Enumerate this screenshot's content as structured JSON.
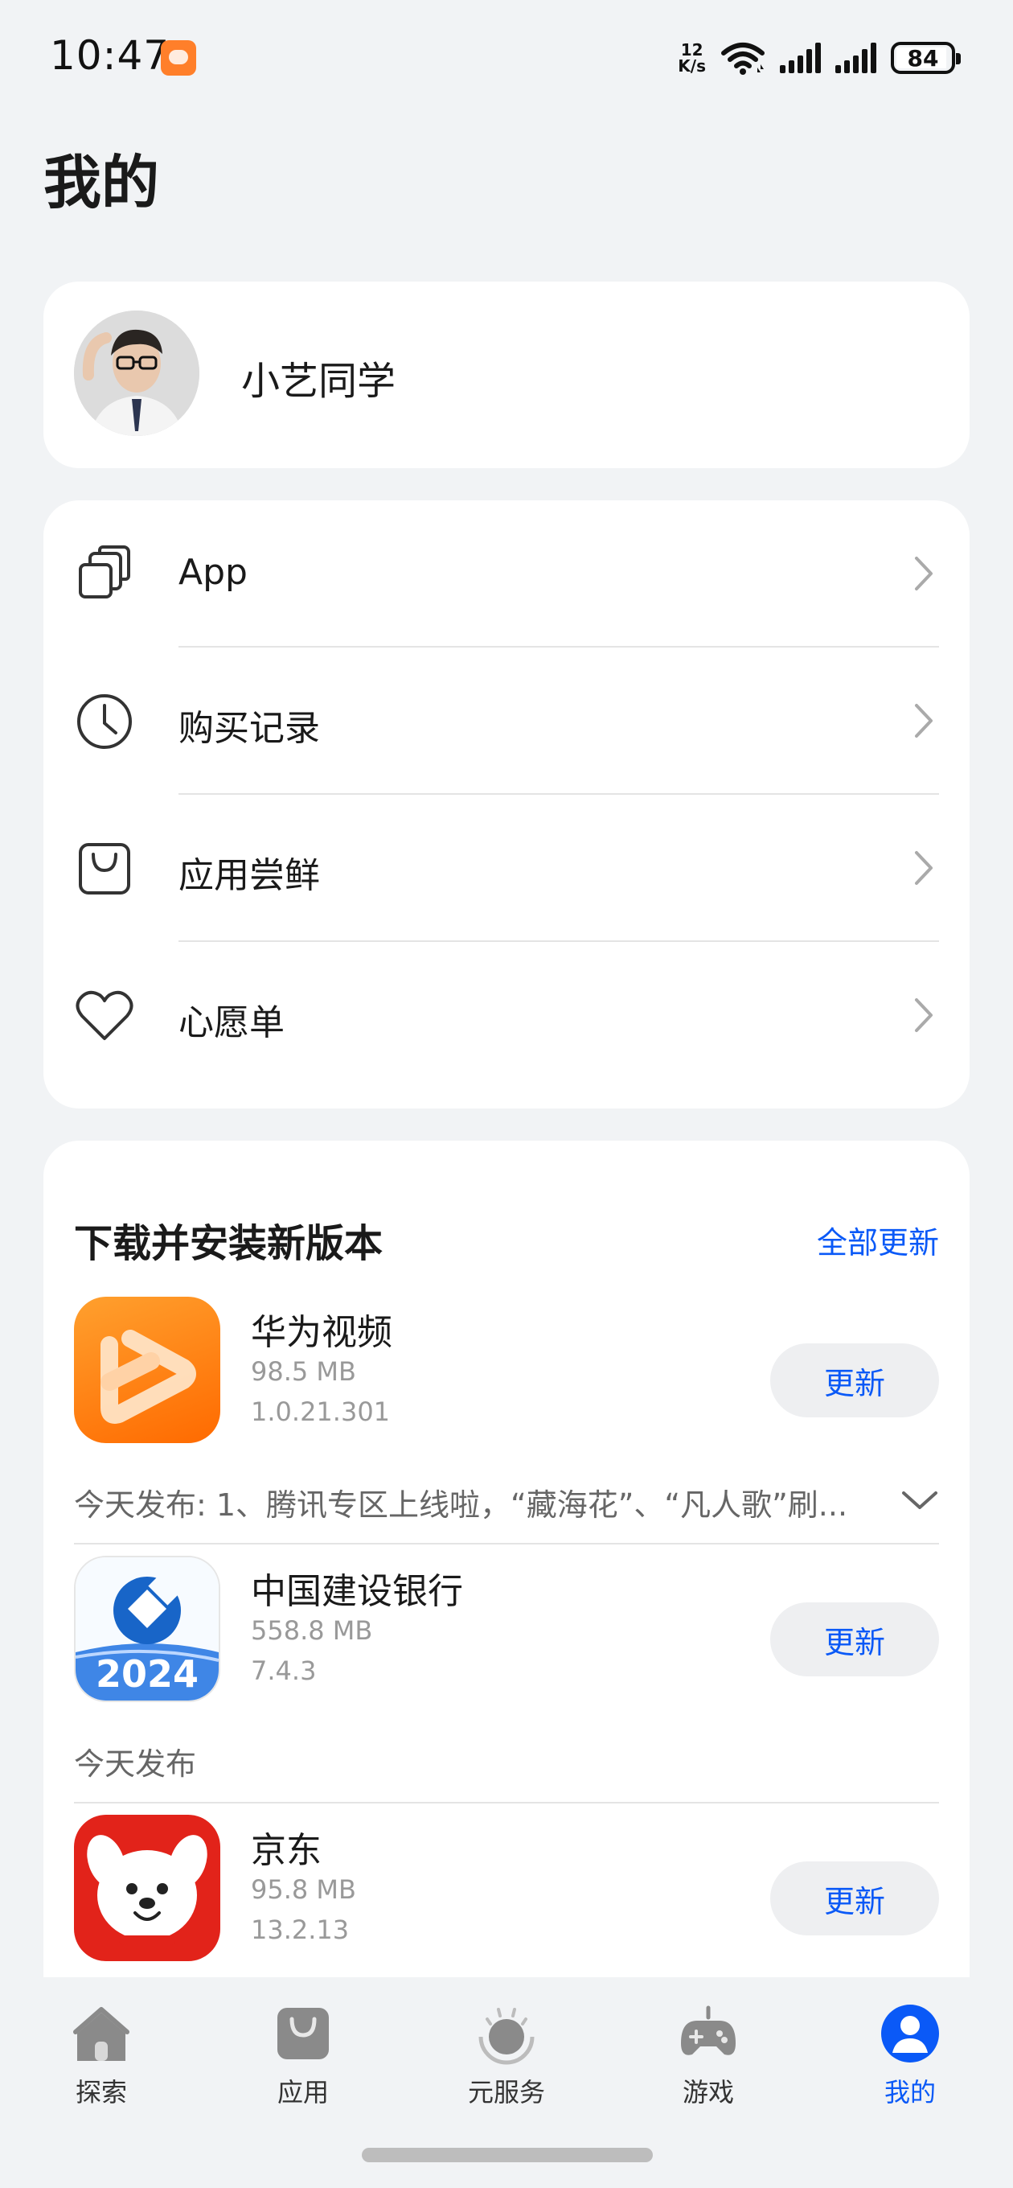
{
  "status_bar": {
    "time": "10:47",
    "net_speed_value": "12",
    "net_speed_unit": "K/s",
    "battery": "84"
  },
  "page": {
    "title": "我的"
  },
  "profile": {
    "name": "小艺同学"
  },
  "menu": {
    "items": [
      {
        "label": "App",
        "icon": "stacked-windows-icon"
      },
      {
        "label": "购买记录",
        "icon": "clock-icon"
      },
      {
        "label": "应用尝鲜",
        "icon": "shopping-bag-icon"
      },
      {
        "label": "心愿单",
        "icon": "heart-icon"
      }
    ]
  },
  "updates": {
    "title": "下载并安装新版本",
    "update_all": "全部更新",
    "apps": [
      {
        "name": "华为视频",
        "size": "98.5 MB",
        "version": "1.0.21.301",
        "button": "更新",
        "note": "今天发布: 1、腾讯专区上线啦，“藏海花”、“凡人歌”刷..."
      },
      {
        "name": "中国建设银行",
        "size": "558.8 MB",
        "version": "7.4.3",
        "button": "更新",
        "note": "今天发布",
        "icon_text": "2024"
      },
      {
        "name": "京东",
        "size": "95.8 MB",
        "version": "13.2.13",
        "button": "更新"
      }
    ]
  },
  "tabs": [
    {
      "label": "探索",
      "icon": "house-icon",
      "active": false
    },
    {
      "label": "应用",
      "icon": "bag-icon",
      "active": false
    },
    {
      "label": "元服务",
      "icon": "atomic-service-icon",
      "active": false
    },
    {
      "label": "游戏",
      "icon": "gamepad-icon",
      "active": false
    },
    {
      "label": "我的",
      "icon": "person-icon",
      "active": true
    }
  ],
  "colors": {
    "accent": "#0a59f7",
    "background": "#f1f3f5",
    "card": "#ffffff"
  }
}
